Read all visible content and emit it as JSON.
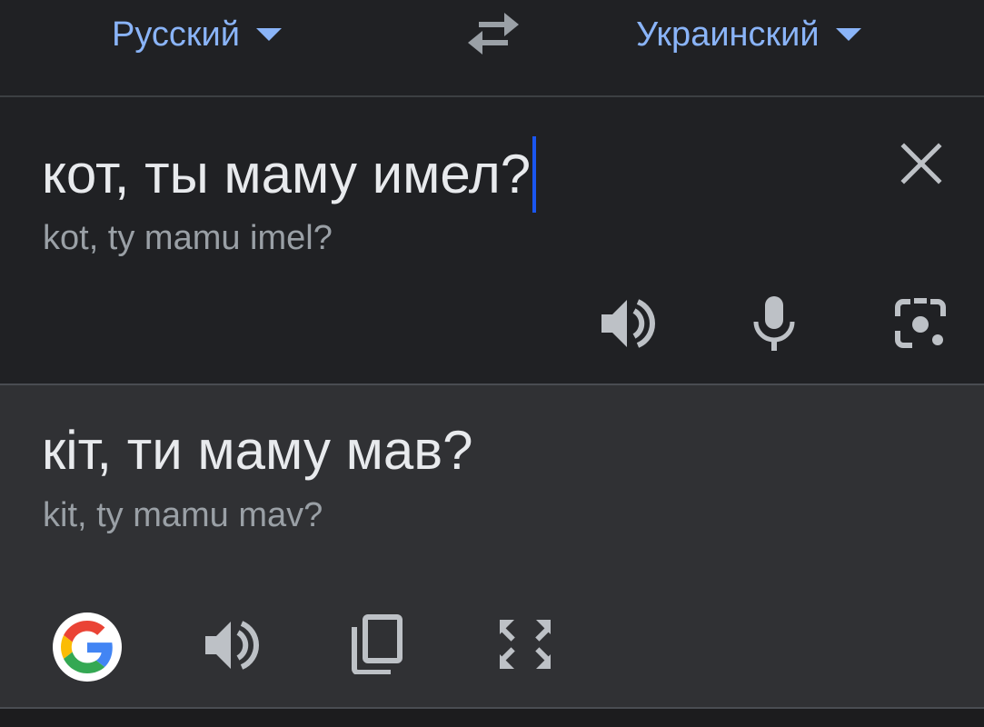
{
  "header": {
    "source_language": "Русский",
    "target_language": "Украинский"
  },
  "input": {
    "text": "кот, ты маму имел?",
    "transliteration": "kot, ty mamu imel?"
  },
  "output": {
    "text": "кіт, ти маму мав?",
    "transliteration": "kit, ty mamu mav?"
  },
  "icons": {
    "language_dropdown": "caret-down-icon",
    "swap": "swap-languages-icon",
    "clear": "close-icon",
    "speaker": "speaker-icon",
    "microphone": "microphone-icon",
    "camera": "camera-lens-icon",
    "google": "google-logo",
    "copy": "copy-icon",
    "fullscreen": "fullscreen-icon"
  },
  "colors": {
    "accent": "#8ab4f8",
    "cursor": "#1a56f0",
    "background": "#202124",
    "output_background": "#303134",
    "text_primary": "#e8eaed",
    "text_secondary": "#9aa0a6",
    "icon": "#bdc1c6"
  }
}
